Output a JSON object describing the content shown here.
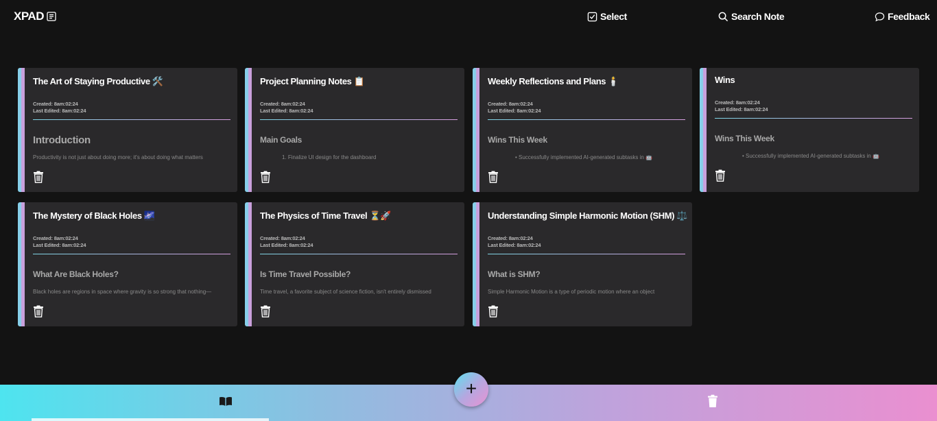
{
  "app": {
    "logo_text": "XPAD",
    "nav": {
      "select_label": "Select",
      "search_label": "Search Note",
      "feedback_label": "Feedback"
    }
  },
  "notes": [
    {
      "title": "The Art of Staying Productive 🛠️",
      "created": "Created: 8am:02:24",
      "edited": "Last Edited: 8am:02:24",
      "heading": "Introduction",
      "preview": "Productivity is not just about doing more; it's about doing what matters"
    },
    {
      "title": "Project Planning Notes 📋",
      "created": "Created: 8am:02:24",
      "edited": "Last Edited: 8am:02:24",
      "heading": "Main Goals",
      "preview": "1.  Finalize UI design for the dashboard"
    },
    {
      "title": "Weekly Reflections and Plans 🕯️",
      "created": "Created: 8am:02:24",
      "edited": "Last Edited: 8am:02:24",
      "heading": "Wins This Week",
      "preview": "•   Successfully implemented AI-generated subtasks in 🤖"
    },
    {
      "title": "Wins",
      "created": "Created: 8am:02:24",
      "edited": "Last Edited: 8am:02:24",
      "heading": "Wins This Week",
      "preview": "•   Successfully implemented AI-generated subtasks in 🤖"
    },
    {
      "title": "The Mystery of Black Holes 🌌",
      "created": "Created: 8am:02:24",
      "edited": "Last Edited: 8am:02:24",
      "heading": "What Are Black Holes?",
      "preview": "Black holes are regions in space where gravity is so strong that nothing—"
    },
    {
      "title": "The Physics of Time Travel ⏳🚀",
      "created": "Created: 8am:02:24",
      "edited": "Last Edited: 8am:02:24",
      "heading": "Is Time Travel Possible?",
      "preview": "Time travel, a favorite subject of science fiction, isn't entirely dismissed"
    },
    {
      "title": "Understanding Simple Harmonic Motion (SHM) ⚖️",
      "created": "Created: 8am:02:24",
      "edited": "Last Edited: 8am:02:24",
      "heading": "What is SHM?",
      "preview": "Simple Harmonic Motion is a type of periodic motion where an object"
    }
  ],
  "bottom_bar": {
    "add_label": "+",
    "left_icon": "book-icon",
    "right_icon": "trash-icon"
  },
  "colors": {
    "background": "#131313",
    "card": "#2a292b",
    "accent_cyan": "#4ee4ef",
    "accent_pink": "#ea8fd0"
  }
}
